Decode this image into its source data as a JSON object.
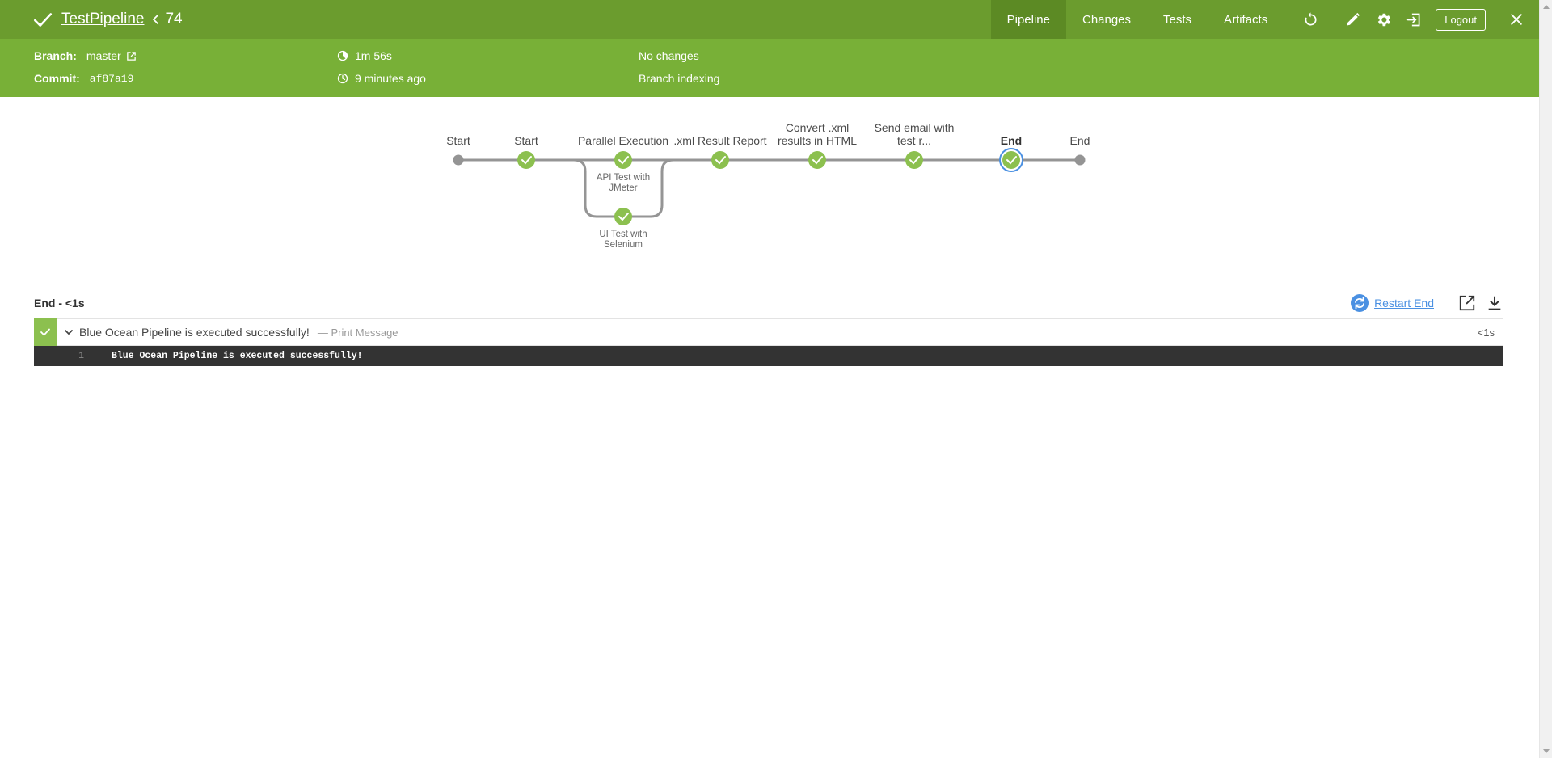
{
  "header": {
    "pipeline_name": "TestPipeline",
    "run_number": "74",
    "nav": {
      "pipeline": "Pipeline",
      "changes": "Changes",
      "tests": "Tests",
      "artifacts": "Artifacts"
    },
    "logout": "Logout",
    "icons": [
      "replay-icon",
      "edit-icon",
      "gear-icon",
      "exit-icon",
      "close-icon"
    ]
  },
  "meta": {
    "branch_label": "Branch:",
    "branch_value": "master",
    "commit_label": "Commit:",
    "commit_value": "af87a19",
    "duration": "1m 56s",
    "time_ago": "9 minutes ago",
    "changes": "No changes",
    "cause": "Branch indexing"
  },
  "graph": {
    "stages": [
      {
        "label": "Start",
        "status": "none"
      },
      {
        "label": "Start",
        "status": "success"
      },
      {
        "label": "Parallel Execution",
        "status": "success"
      },
      {
        "label": ".xml Result Report",
        "status": "success"
      },
      {
        "label": "Convert .xml results in HTML",
        "line1": "Convert .xml",
        "line2": "results in HTML",
        "status": "success"
      },
      {
        "label": "Send email with test r...",
        "line1": "Send email with",
        "line2": "test r...",
        "status": "success"
      },
      {
        "label": "End",
        "status": "success",
        "selected": true
      },
      {
        "label": "End",
        "status": "none"
      }
    ],
    "branches": [
      {
        "line1": "API Test with",
        "line2": "JMeter"
      },
      {
        "line1": "UI Test with",
        "line2": "Selenium"
      }
    ]
  },
  "log": {
    "step_title": "End - <1s",
    "restart_label": "Restart End",
    "step_text": "Blue Ocean Pipeline is executed successfully!",
    "step_sub": "— Print Message",
    "step_duration": "<1s",
    "lines": [
      {
        "no": "1",
        "text": "Blue Ocean Pipeline is executed successfully!"
      }
    ]
  },
  "colors": {
    "topbar": "#6b9c2e",
    "subbar": "#78b037",
    "success": "#8cc04f",
    "selected_ring": "#4a90e2",
    "link": "#4a90e2"
  }
}
